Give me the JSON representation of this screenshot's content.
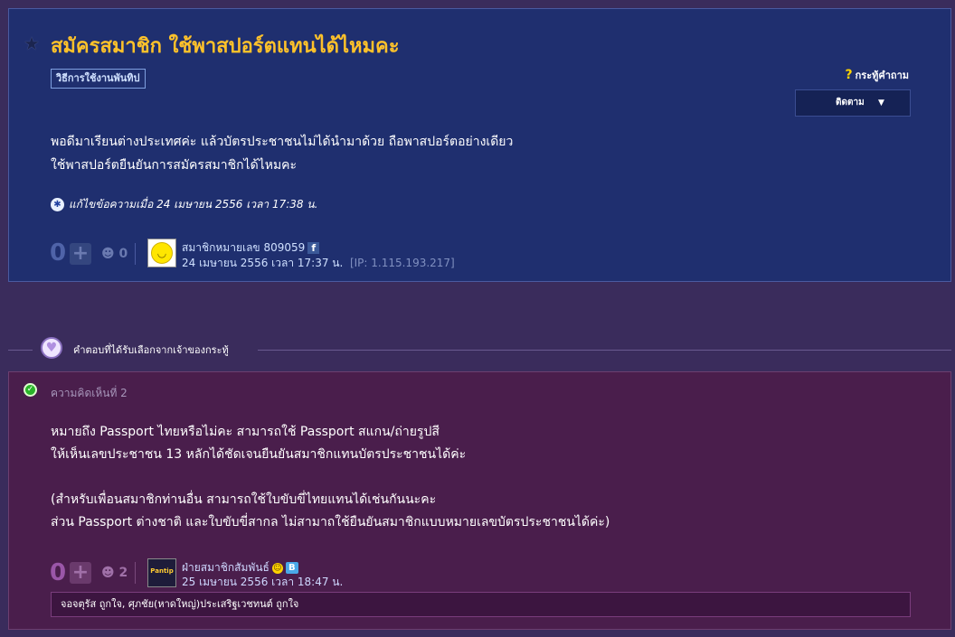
{
  "topic": {
    "title": "สมัครสมาชิก ใช้พาสปอร์ตแทนได้ไหมคะ",
    "tag": "วิธีการใช้งานพันทิป",
    "topic_type": "กระทู้คำถาม",
    "follow_label": "ติดตาม",
    "body_line1": "พอดีมาเรียนต่างประเทศค่ะ แล้วบัตรประชาชนไม่ได้นำมาด้วย ถือพาสปอร์ตอย่างเดียว",
    "body_line2": "ใช้พาสปอร์ตยืนยันการสมัครสมาชิกได้ไหมคะ",
    "edit_note": "แก้ไขข้อความเมื่อ 24 เมษายน 2556 เวลา 17:38 น.",
    "votes": "0",
    "emotions": "0",
    "author": "สมาชิกหมายเลข 809059",
    "date": "24 เมษายน 2556 เวลา 17:37 น.",
    "ip": "[IP: 1.115.193.217]",
    "fb_icon": "f"
  },
  "divider": {
    "label": "คำตอบที่ได้รับเลือกจากเจ้าของกระทู้"
  },
  "reply": {
    "comment_number": "ความคิดเห็นที่ 2",
    "line1": "หมายถึง Passport ไทยหรือไม่คะ  สามารถใช้ Passport สแกน/ถ่ายรูปสี",
    "line2": "ให้เห็นเลขประชาชน 13 หลักได้ชัดเจนยืนยันสมาชิกแทนบัตรประชาชนได้ค่ะ",
    "line3": "(สำหรับเพื่อนสมาชิกท่านอื่น สามารถใช้ใบขับขี่ไทยแทนได้เช่นกันนะคะ",
    "line4": "ส่วน Passport ต่างชาติ และใบขับขี่สากล ไม่สามาถใช้ยืนยันสมาชิกแบบหมายเลขบัตรประชาชนได้ค่ะ)",
    "votes": "0",
    "emotions": "2",
    "author": "ฝ่ายสมาชิกสัมพันธ์",
    "avatar_text": "Pantip",
    "badge": "B",
    "date": "25 เมษายน 2556 เวลา 18:47 น.",
    "likes": "จอจตุรัส ถูกใจ, ศุภชัย(หาดใหญ่)ประเสริฐเวชทนต์ ถูกใจ"
  },
  "colors": {
    "title": "#ffc22a",
    "topic_bg": "#1f2f6f",
    "reply_bg": "#4a1e4c",
    "page_bg": "#3a2c5c"
  }
}
